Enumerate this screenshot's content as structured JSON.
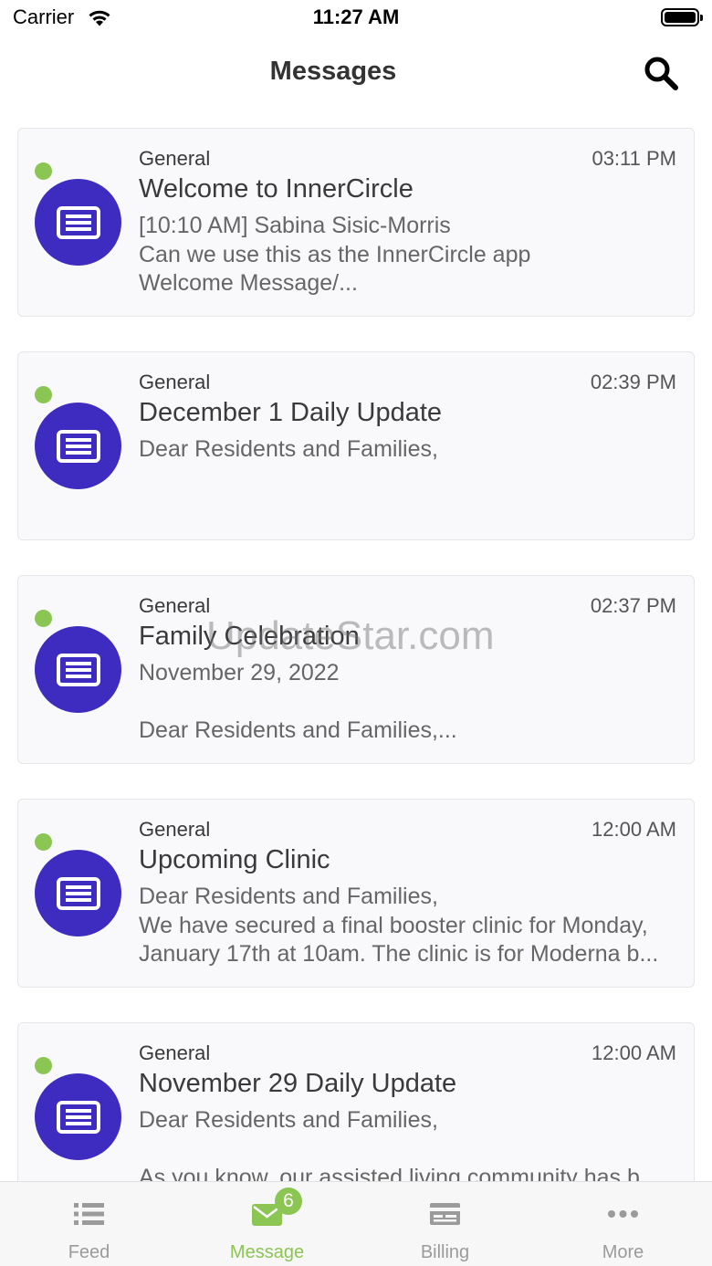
{
  "status_bar": {
    "carrier": "Carrier",
    "time": "11:27 AM"
  },
  "header": {
    "title": "Messages"
  },
  "messages": [
    {
      "category": "General",
      "time": "03:11 PM",
      "title": "Welcome to InnerCircle",
      "preview": "[10:10 AM] Sabina Sisic-Morris\nCan we use this as the InnerCircle app\nWelcome Message/...",
      "unread": true
    },
    {
      "category": "General",
      "time": "02:39 PM",
      "title": "December 1 Daily Update",
      "preview": "Dear Residents and Families,",
      "unread": true
    },
    {
      "category": "General",
      "time": "02:37 PM",
      "title": "Family Celebration",
      "preview": "November 29, 2022\n\nDear Residents and Families,...",
      "unread": true
    },
    {
      "category": "General",
      "time": "12:00 AM",
      "title": "Upcoming Clinic",
      "preview": "Dear Residents and Families,\nWe have secured a final booster clinic for Monday,\nJanuary 17th at 10am. The clinic is for Moderna b...",
      "unread": true
    },
    {
      "category": "General",
      "time": "12:00 AM",
      "title": "November 29 Daily Update",
      "preview": "Dear Residents and Families,\n\nAs you know, our assisted living community has b...",
      "unread": true
    }
  ],
  "watermark": "UpdateStar.com",
  "tabs": [
    {
      "label": "Feed",
      "icon": "list-icon",
      "active": false
    },
    {
      "label": "Message",
      "icon": "envelope-icon",
      "active": true,
      "badge": "6"
    },
    {
      "label": "Billing",
      "icon": "billing-icon",
      "active": false
    },
    {
      "label": "More",
      "icon": "more-dots-icon",
      "active": false
    }
  ],
  "colors": {
    "accent_green": "#8bc553",
    "avatar_purple": "#3d2cbf",
    "card_bg": "#f9f8fa"
  }
}
